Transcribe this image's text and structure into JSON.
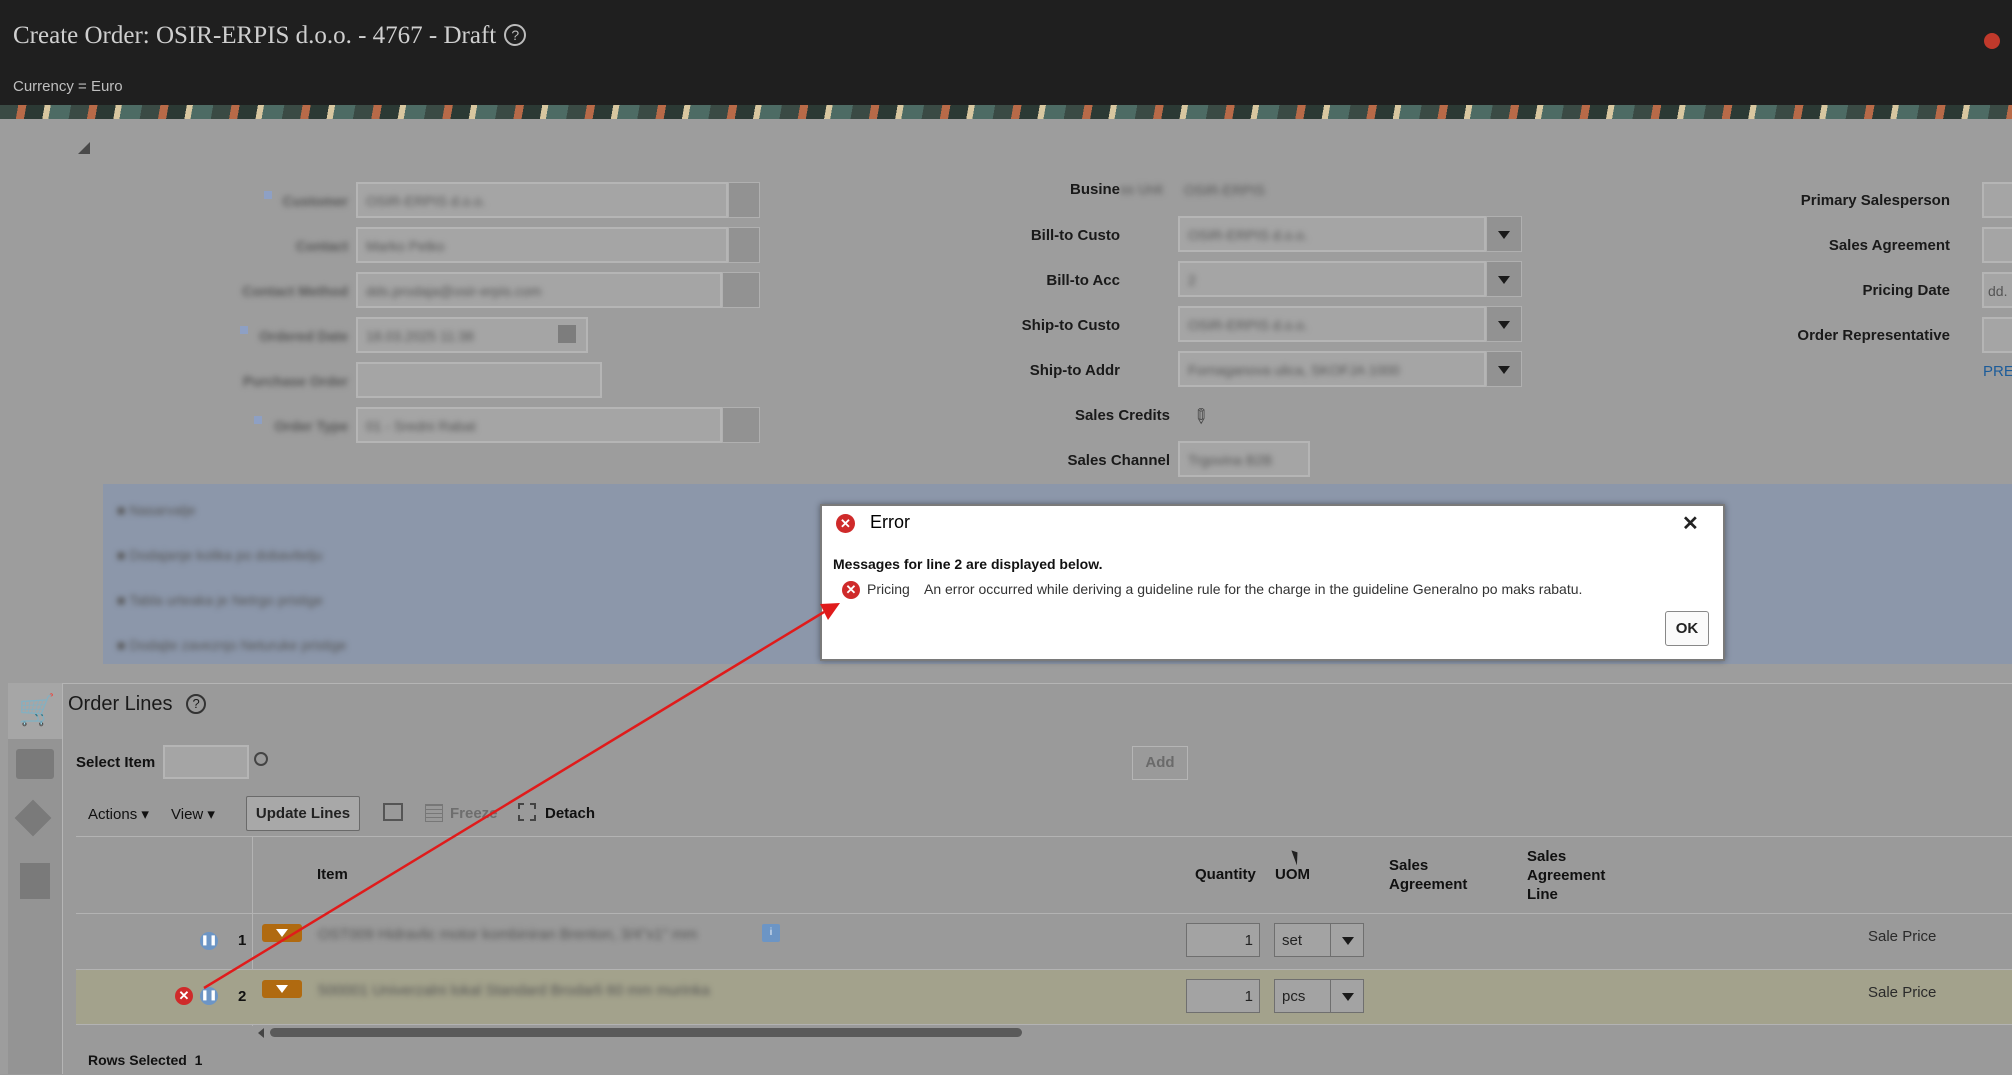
{
  "header": {
    "title": "Create Order: OSIR-ERPIS d.o.o. - 4767 - Draft",
    "currency": "Currency = Euro"
  },
  "form": {
    "right_labels": [
      "Primary Salesperson",
      "Sales Agreement",
      "Pricing Date",
      "Order Representative"
    ],
    "pricing_date_placeholder": "dd.",
    "pre_link": "PRE",
    "middle_labels": [
      "Busine",
      "Bill-to Custo",
      "Bill-to Acc",
      "Ship-to Custo",
      "Ship-to Addr",
      "Sales Credits",
      "Sales Channel"
    ]
  },
  "order_lines": {
    "title": "Order Lines",
    "select_item_label": "Select Item",
    "add_button": "Add",
    "toolbar": {
      "actions": "Actions",
      "view": "View",
      "update_lines": "Update Lines",
      "freeze": "Freeze",
      "detach": "Detach"
    },
    "columns": {
      "item": "Item",
      "quantity": "Quantity",
      "uom": "UOM",
      "sales_agreement": "Sales Agreement",
      "sales_agreement_line": "Sales Agreement Line"
    },
    "rows": [
      {
        "num": "1",
        "qty": "1",
        "uom": "set",
        "price_type": "Sale Price"
      },
      {
        "num": "2",
        "qty": "1",
        "uom": "pcs",
        "price_type": "Sale Price"
      }
    ],
    "rows_selected_label": "Rows Selected",
    "rows_selected_count": "1"
  },
  "dialog": {
    "title": "Error",
    "message_header": "Messages for line 2 are displayed below.",
    "source": "Pricing",
    "message": "An error occurred while deriving a guideline rule for the charge in the guideline Generalno po maks rabatu.",
    "ok_label": "OK",
    "close_glyph": "✕"
  },
  "colors": {
    "error_red": "#cf2a2a",
    "arrow_red": "#e01b1b",
    "header_bg": "#1f1f1f"
  }
}
